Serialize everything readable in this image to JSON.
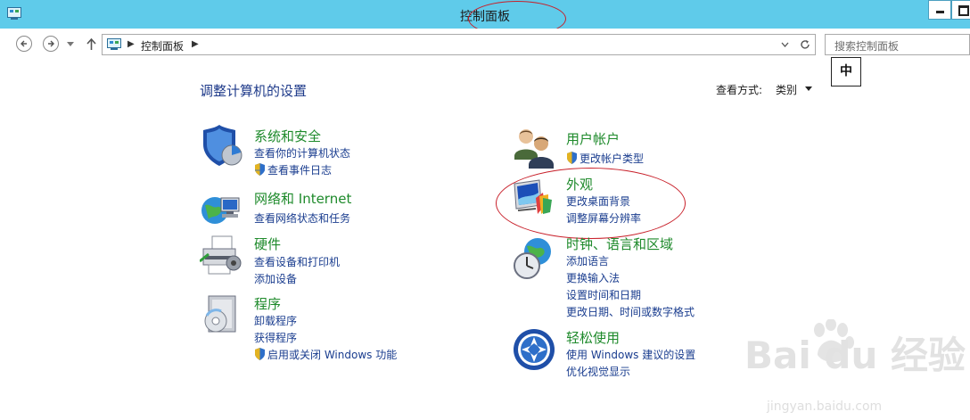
{
  "window": {
    "title": "控制面板"
  },
  "address": {
    "crumb": "控制面板"
  },
  "search": {
    "placeholder": "搜索控制面板"
  },
  "ime": {
    "label": "中"
  },
  "page": {
    "heading": "调整计算机的设置"
  },
  "view_by": {
    "label": "查看方式:",
    "value": "类别"
  },
  "categories": [
    {
      "title": "系统和安全",
      "icon": "shield-icon",
      "links": [
        "查看你的计算机状态",
        "查看事件日志"
      ]
    },
    {
      "title": "网络和 Internet",
      "icon": "network-globe-icon",
      "links": [
        "查看网络状态和任务"
      ]
    },
    {
      "title": "硬件",
      "icon": "printer-icon",
      "links": [
        "查看设备和打印机",
        "添加设备"
      ]
    },
    {
      "title": "程序",
      "icon": "programs-icon",
      "links": [
        "卸载程序",
        "获得程序",
        "启用或关闭 Windows 功能"
      ]
    },
    {
      "title": "用户帐户",
      "icon": "users-icon",
      "links": [
        "更改帐户类型"
      ]
    },
    {
      "title": "外观",
      "icon": "appearance-icon",
      "links": [
        "更改桌面背景",
        "调整屏幕分辨率"
      ]
    },
    {
      "title": "时钟、语言和区域",
      "icon": "clock-globe-icon",
      "links": [
        "添加语言",
        "更换输入法",
        "设置时间和日期",
        "更改日期、时间或数字格式"
      ]
    },
    {
      "title": "轻松使用",
      "icon": "ease-of-access-icon",
      "links": [
        "使用 Windows 建议的设置",
        "优化视觉显示"
      ]
    }
  ],
  "watermark": {
    "text": "Bai du 经验",
    "sub": "jingyan.baidu.com"
  },
  "colors": {
    "titlebar": "#5fcbea",
    "category_title": "#1e8a2b",
    "link": "#1a3d8f",
    "annotation": "#c8202a"
  }
}
